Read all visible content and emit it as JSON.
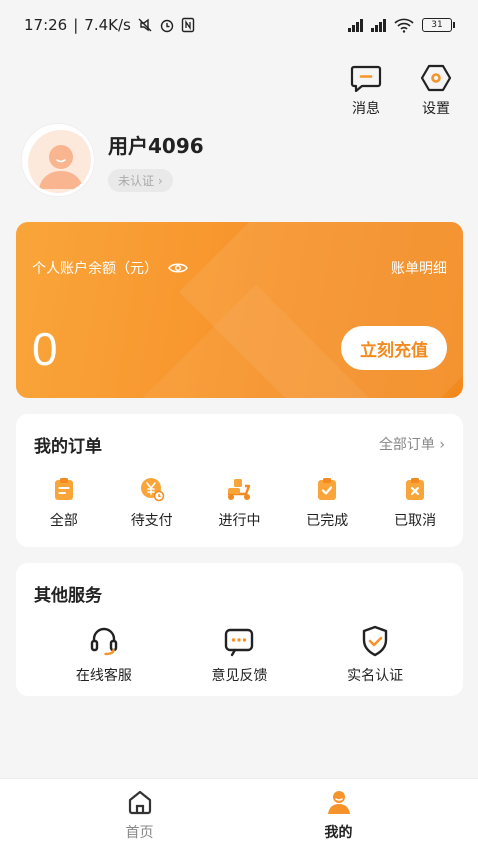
{
  "status_bar": {
    "time": "17:26",
    "speed": "7.4K/s",
    "battery": "31"
  },
  "top_actions": {
    "message_label": "消息",
    "settings_label": "设置"
  },
  "profile": {
    "username": "用户4096",
    "cert_status": "未认证 ›"
  },
  "balance": {
    "label": "个人账户余额（元）",
    "bill_link": "账单明细",
    "amount": "0",
    "recharge_label": "立刻充值"
  },
  "orders": {
    "title": "我的订单",
    "more": "全部订单 ›",
    "items": [
      {
        "label": "全部",
        "icon": "clipboard-icon"
      },
      {
        "label": "待支付",
        "icon": "yen-coin-icon"
      },
      {
        "label": "进行中",
        "icon": "scooter-icon"
      },
      {
        "label": "已完成",
        "icon": "clipboard-check-icon"
      },
      {
        "label": "已取消",
        "icon": "clipboard-x-icon"
      }
    ]
  },
  "services": {
    "title": "其他服务",
    "items": [
      {
        "label": "在线客服",
        "icon": "headset-icon"
      },
      {
        "label": "意见反馈",
        "icon": "feedback-icon"
      },
      {
        "label": "实名认证",
        "icon": "shield-check-icon"
      }
    ]
  },
  "bottom_nav": {
    "home_label": "首页",
    "mine_label": "我的"
  },
  "colors": {
    "accent": "#f7932b",
    "accent_light": "#f9a53a"
  }
}
